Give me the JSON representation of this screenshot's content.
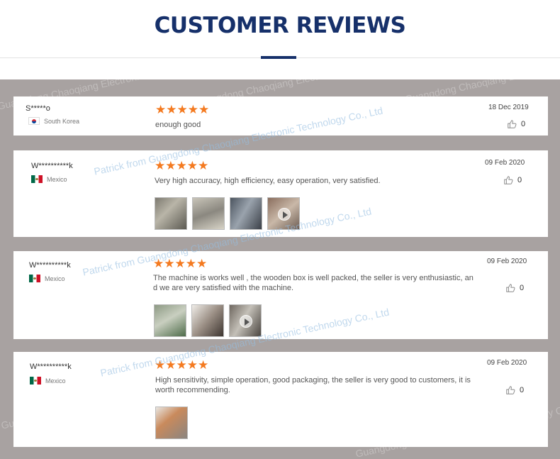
{
  "page": {
    "title": "CUSTOMER REVIEWS"
  },
  "watermark": {
    "line1": "Guangdong Chaoqiang Electronic Technology Co., Ltd",
    "line2": "Patrick from Guangdong Chaoqiang Electronic Technology Co., Ltd"
  },
  "colors": {
    "title": "#16306a",
    "star": "#f47a20",
    "panel": "#a8a2a1"
  },
  "reviews": [
    {
      "user": "S*****o",
      "country": "South Korea",
      "flag": "south-korea-flag",
      "rating": 5,
      "stars": "★★★★★",
      "text": "enough good",
      "date": "18 Dec 2019",
      "likes": "0",
      "photos": []
    },
    {
      "user": "W**********k",
      "country": "Mexico",
      "flag": "mexico-flag",
      "rating": 5,
      "stars": "★★★★★",
      "text": "Very high accuracy, high efficiency, easy operation, very satisfied.",
      "date": "09 Feb 2020",
      "likes": "0",
      "photos": [
        "machine-photo",
        "machine-photo",
        "machine-photo",
        "video-thumbnail"
      ]
    },
    {
      "user": "W**********k",
      "country": "Mexico",
      "flag": "mexico-flag",
      "rating": 5,
      "stars": "★★★★★",
      "text_line1": "The machine is works well , the wooden box is well packed, the seller is very enthusiastic, an",
      "text_line2": "d we are very satisfied with the machine.",
      "date": "09 Feb 2020",
      "likes": "0",
      "photos": [
        "machine-photo",
        "machine-photo",
        "video-thumbnail"
      ]
    },
    {
      "user": "W**********k",
      "country": "Mexico",
      "flag": "mexico-flag",
      "rating": 5,
      "stars": "★★★★★",
      "text_line1": "High sensitivity, simple operation, good packaging, the seller is very good to customers, it is",
      "text_line2": "worth recommending.",
      "date": "09 Feb 2020",
      "likes": "0",
      "photos": [
        "machine-photo"
      ]
    }
  ]
}
